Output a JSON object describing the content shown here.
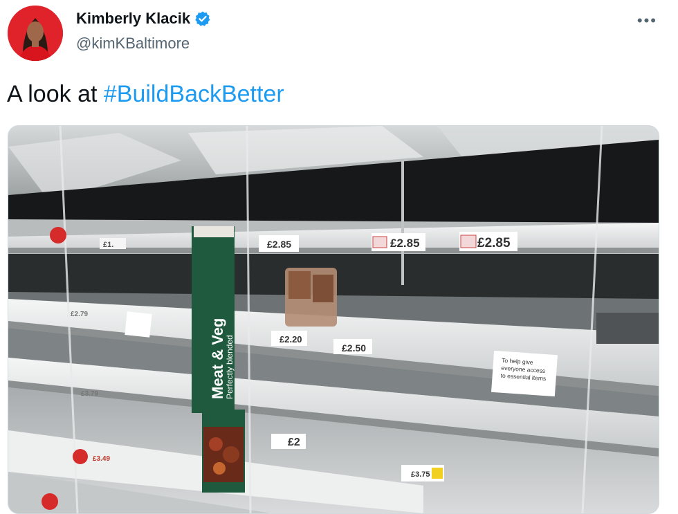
{
  "author": {
    "display_name": "Kimberly Klacik",
    "handle": "@kimKBaltimore"
  },
  "tweet": {
    "text_prefix": "A look at ",
    "hashtag": "#BuildBackBetter"
  },
  "menu": {
    "more_label": "•••"
  },
  "photo": {
    "sign_title": "Meat & Veg",
    "sign_subtitle": "Perfectly blended",
    "prices": {
      "top_a": "£1.",
      "top_b": "£2.85",
      "top_c": "£2.85",
      "top_d": "£2.85",
      "mid_a": "£2.79",
      "mid_b": "£2.20",
      "mid_c": "£2.50",
      "low_a": "£3.79",
      "low_b": "£2",
      "bot_a": "£3.49",
      "bot_b": "£3.75"
    },
    "notice": [
      "To help give",
      "everyone access",
      "to essential items"
    ]
  },
  "colors": {
    "link": "#1d9bf0",
    "verified": "#1d9bf0",
    "sign_green": "#1f5a3e"
  }
}
